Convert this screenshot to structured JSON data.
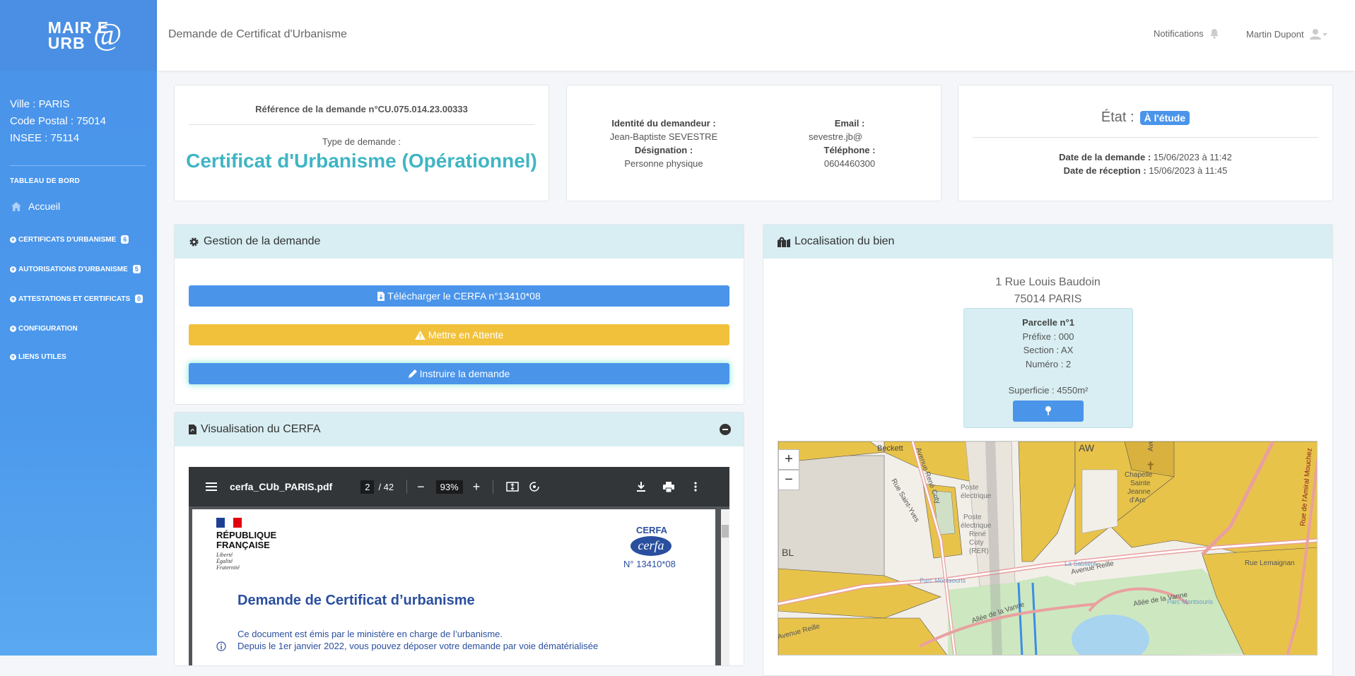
{
  "logo": {
    "line1": "MAIR E",
    "line2": "URB",
    "at": "@"
  },
  "sidebar": {
    "ville": "Ville : PARIS",
    "code_postal": "Code Postal : 75014",
    "insee": "INSEE : 75114",
    "section_title": "TABLEAU DE BORD",
    "accueil": "Accueil",
    "menu": [
      {
        "label": "CERTIFICATS D'URBANISME",
        "badge": "6"
      },
      {
        "label": "AUTORISATIONS D'URBANISME",
        "badge": "5"
      },
      {
        "label": "ATTESTATIONS ET CERTIFICATS",
        "badge": "0"
      },
      {
        "label": "CONFIGURATION",
        "badge": ""
      },
      {
        "label": "LIENS UTILES",
        "badge": ""
      }
    ]
  },
  "header": {
    "title": "Demande de Certificat d'Urbanisme",
    "notifications": "Notifications",
    "user": "Martin Dupont"
  },
  "ref_card": {
    "reference": "Référence de la demande n°CU.075.014.23.00333",
    "type_label": "Type de demande :",
    "type_value": "Certificat d'Urbanisme (Opérationnel)"
  },
  "applicant": {
    "identity_label": "Identité du demandeur :",
    "identity_value": "Jean-Baptiste SEVESTRE",
    "designation_label": "Désignation :",
    "designation_value": "Personne physique",
    "email_label": "Email :",
    "email_value": "sevestre.jb@",
    "phone_label": "Téléphone :",
    "phone_value": "0604460300"
  },
  "state": {
    "label": "État :",
    "badge": "À l'étude",
    "date_demande_label": "Date de la demande :",
    "date_demande": "15/06/2023 à 11:42",
    "date_reception_label": "Date de réception :",
    "date_reception": "15/06/2023 à 11:45"
  },
  "gestion": {
    "title": "Gestion de la demande",
    "btn_download": "Télécharger le CERFA n°13410*08",
    "btn_wait": "Mettre en Attente",
    "btn_instruct": "Instruire la demande"
  },
  "cerfa_view": {
    "title": "Visualisation du CERFA",
    "file": "cerfa_CUb_PARIS.pdf",
    "page": "2",
    "pages": "/ 42",
    "zoom": "93%",
    "rf1": "RÉPUBLIQUE",
    "rf2": "FRANÇAISE",
    "motto1": "Liberté",
    "motto2": "Égalité",
    "motto3": "Fraternité",
    "cerfa_label": "CERFA",
    "cerfa_logo": "cerfa",
    "cerfa_num": "N° 13410*08",
    "doc_title": "Demande de Certificat d’urbanisme",
    "line1": "Ce document est émis par le ministère en charge de l’urbanisme.",
    "line2": "Depuis le 1er janvier 2022, vous pouvez déposer votre demande par voie dématérialisée"
  },
  "localisation": {
    "title": "Localisation du bien",
    "address1": "1 Rue Louis Baudoin",
    "address2": "75014 PARIS",
    "parcelle": "Parcelle n°1",
    "prefixe": "Préfixe : 000",
    "section": "Section : AX",
    "numero": "Numéro : 2",
    "superficie": "Superficie : 4550m²"
  },
  "map": {
    "zoom_in": "+",
    "zoom_out": "−",
    "labels": [
      "Avenue René Coty",
      "Rue Saint-Yves",
      "Poste électrique",
      "Poste électrique René Coty (RER)",
      "Avenue Reille",
      "Allée de la Vanne",
      "Parc Montsouris",
      "Rue Lemaignan",
      "Chapelle Sainte Jeanne d'Arc",
      "Rue de l'Amiral Mouchez",
      "BL",
      "AW",
      "Beckett",
      "La Sablière"
    ]
  }
}
